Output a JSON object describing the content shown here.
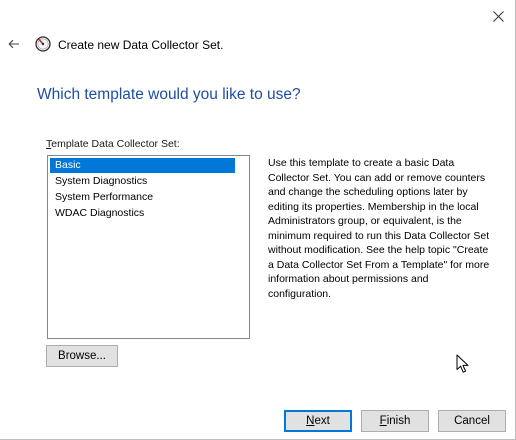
{
  "window": {
    "title": "Create new Data Collector Set."
  },
  "icons": {
    "close": "close-icon",
    "back": "back-arrow-icon",
    "app": "data-collector-gauge-icon",
    "cursor": "mouse-pointer-icon"
  },
  "heading": "Which template would you like to use?",
  "template_list": {
    "label_mnemonic": "T",
    "label_rest": "emplate Data Collector Set:",
    "items": [
      {
        "label": "Basic",
        "selected": true
      },
      {
        "label": "System Diagnostics",
        "selected": false
      },
      {
        "label": "System Performance",
        "selected": false
      },
      {
        "label": "WDAC Diagnostics",
        "selected": false
      }
    ]
  },
  "description": "Use this template to create a basic Data Collector Set. You can add or remove counters and change the scheduling options later by editing its properties. Membership in the local Administrators group, or equivalent, is the minimum required to run this Data Collector Set without modification. See the help topic \"Create a Data Collector Set From a Template\" for more information about permissions and configuration.",
  "buttons": {
    "browse": {
      "label": "Browse..."
    },
    "next": {
      "mnemonic": "N",
      "rest": "ext"
    },
    "finish": {
      "mnemonic": "F",
      "rest": "inish"
    },
    "cancel": {
      "label": "Cancel"
    }
  },
  "colors": {
    "heading": "#1f4ea1",
    "selection": "#0078d7",
    "button_face": "#e1e1e1",
    "default_button_border": "#0078d7"
  }
}
